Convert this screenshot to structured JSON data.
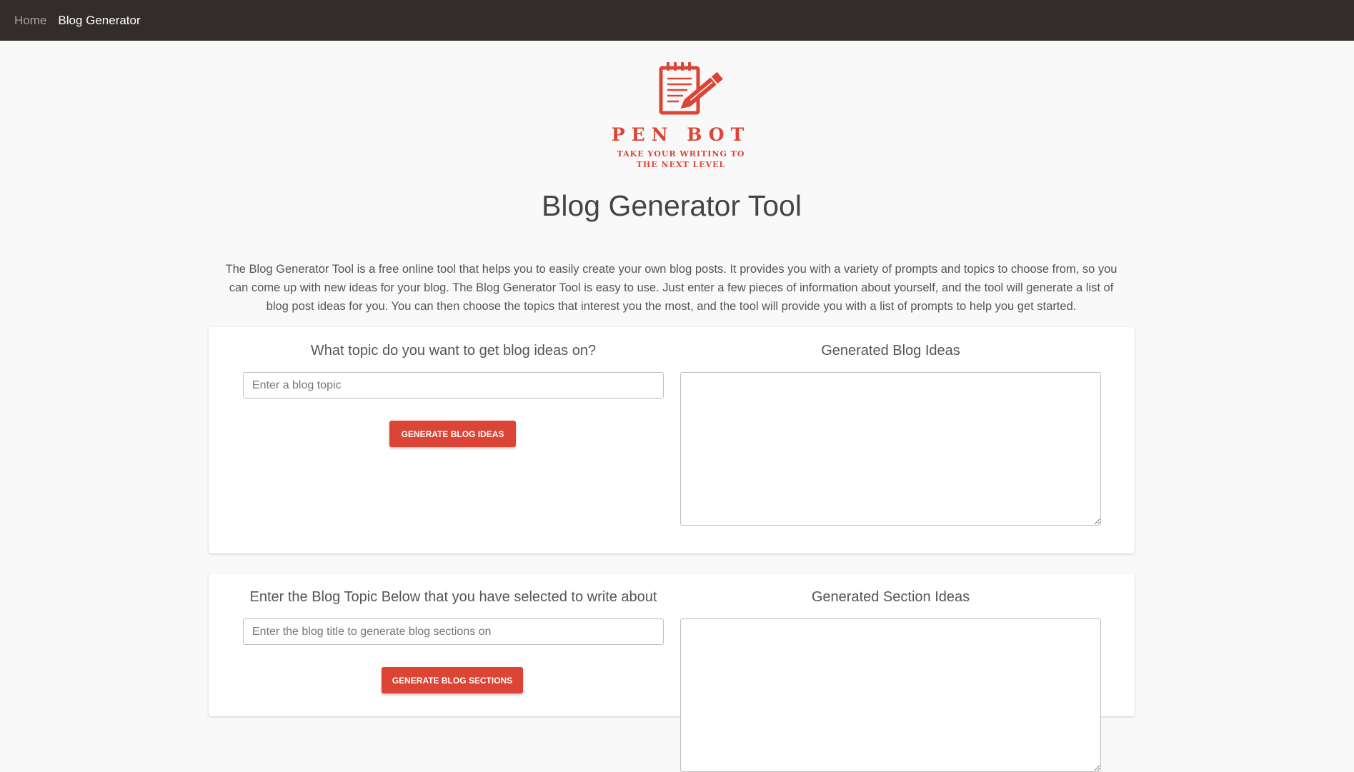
{
  "nav": {
    "home": "Home",
    "blog_generator": "Blog Generator"
  },
  "logo": {
    "brand": "PEN BOT",
    "tagline": "TAKE YOUR WRITING TO THE NEXT LEVEL",
    "icon": "notepad-pencil-icon",
    "color": "#dc4436"
  },
  "title": "Blog Generator Tool",
  "intro": "The Blog Generator Tool is a free online tool that helps you to easily create your own blog posts. It provides you with a variety of prompts and topics to choose from, so you can come up with new ideas for your blog. The Blog Generator Tool is easy to use. Just enter a few pieces of information about yourself, and the tool will generate a list of blog post ideas for you. You can then choose the topics that interest you the most, and the tool will provide you with a list of prompts to help you get started.",
  "ideas_card": {
    "heading": "What topic do you want to get blog ideas on?",
    "input_placeholder": "Enter a blog topic",
    "input_value": "",
    "button": "Generate Blog Ideas",
    "output_heading": "Generated Blog Ideas",
    "output_value": ""
  },
  "sections_card": {
    "heading": "Enter the Blog Topic Below that you have selected to write about",
    "input_placeholder": "Enter the blog title to generate blog sections on",
    "input_value": "",
    "button": "Generate Blog Sections",
    "output_heading": "Generated Section Ideas",
    "output_value": ""
  },
  "colors": {
    "navbar": "#322c2b",
    "accent": "#dc4436",
    "background": "#f9f9f9"
  }
}
